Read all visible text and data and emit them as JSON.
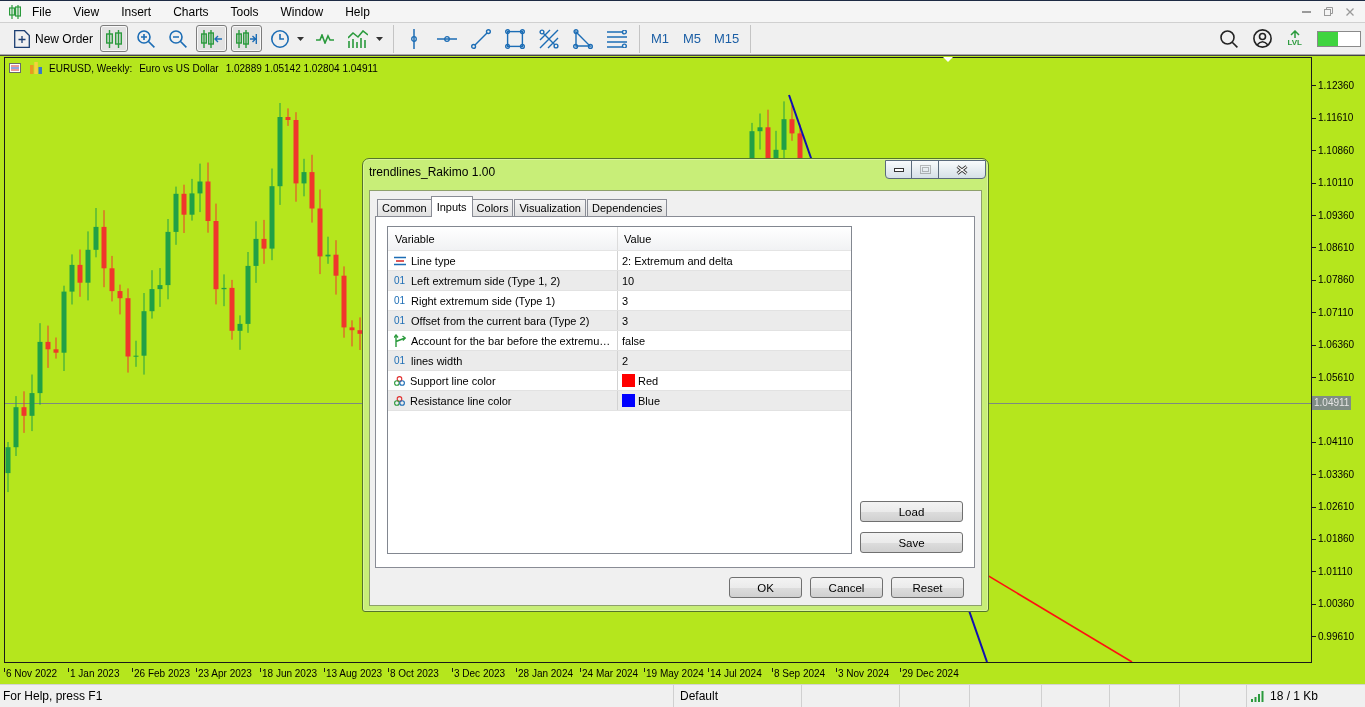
{
  "menu": {
    "items": [
      "File",
      "View",
      "Insert",
      "Charts",
      "Tools",
      "Window",
      "Help"
    ]
  },
  "toolbar": {
    "new_order": "New Order",
    "chart_tools": [
      {
        "kind": "candles",
        "pressed": true
      },
      {
        "kind": "zoom_in",
        "pressed": false
      },
      {
        "kind": "zoom_out",
        "pressed": false
      },
      {
        "kind": "chart_shift",
        "pressed": true
      },
      {
        "kind": "autoscroll",
        "pressed": true
      },
      {
        "kind": "clock",
        "pressed": false
      },
      {
        "kind": "dropdown",
        "pressed": false
      },
      {
        "kind": "indicator",
        "pressed": false
      },
      {
        "kind": "templates",
        "pressed": false
      },
      {
        "kind": "dropdown",
        "pressed": false
      }
    ],
    "drawing_tools": [
      {
        "kind": "vline",
        "pressed": false
      },
      {
        "kind": "hline",
        "pressed": false
      },
      {
        "kind": "trend",
        "pressed": false
      },
      {
        "kind": "rectangle",
        "pressed": false
      },
      {
        "kind": "crossed",
        "pressed": false
      },
      {
        "kind": "triangle",
        "pressed": false
      },
      {
        "kind": "channel",
        "pressed": false
      }
    ],
    "timeframes": [
      {
        "label": "M1",
        "selected": false
      },
      {
        "label": "M5",
        "selected": false
      },
      {
        "label": "M15",
        "selected": false
      }
    ],
    "level_badge": "LVL",
    "progress": {
      "level": 0.47
    }
  },
  "chart": {
    "symbol": "EURUSD, Weekly:",
    "description": "Euro vs US Dollar",
    "ohlc": "1.02889 1.05142 1.02804 1.04911",
    "price_axis": [
      {
        "kind": "tick",
        "text": "1.12360"
      },
      {
        "kind": "tick",
        "text": "1.11610"
      },
      {
        "kind": "tick",
        "text": "1.10860"
      },
      {
        "kind": "tick",
        "text": "1.10110"
      },
      {
        "kind": "tick",
        "text": "1.09360"
      },
      {
        "kind": "tick",
        "text": "1.08610"
      },
      {
        "kind": "tick",
        "text": "1.07860"
      },
      {
        "kind": "tick",
        "text": "1.07110"
      },
      {
        "kind": "tick",
        "text": "1.06360"
      },
      {
        "kind": "tick",
        "text": "1.05610"
      },
      {
        "kind": "current",
        "text": "1.04911"
      },
      {
        "kind": "tick",
        "text": "1.04110"
      },
      {
        "kind": "tick",
        "text": "1.03360"
      },
      {
        "kind": "tick",
        "text": "1.02610"
      },
      {
        "kind": "tick",
        "text": "1.01860"
      },
      {
        "kind": "tick",
        "text": "1.01110"
      },
      {
        "kind": "tick",
        "text": "1.00360"
      },
      {
        "kind": "tick",
        "text": "0.99610"
      }
    ],
    "time_axis": [
      "6 Nov 2022",
      "1 Jan 2023",
      "26 Feb 2023",
      "23 Apr 2023",
      "18 Jun 2023",
      "13 Aug 2023",
      "8 Oct 2023",
      "3 Dec 2023",
      "28 Jan 2024",
      "24 Mar 2024",
      "19 May 2024",
      "14 Jul 2024",
      "8 Sep 2024",
      "3 Nov 2024",
      "29 Dec 2024"
    ]
  },
  "dialog": {
    "title": "trendlines_Rakimo 1.00",
    "window_buttons": [
      {
        "kind": "minimize",
        "disabled": false
      },
      {
        "kind": "maximize",
        "disabled": true
      },
      {
        "kind": "close",
        "disabled": false
      }
    ],
    "tabs": [
      {
        "label": "Common",
        "selected": false
      },
      {
        "label": "Inputs",
        "selected": true
      },
      {
        "label": "Colors",
        "selected": false
      },
      {
        "label": "Visualization",
        "selected": false
      },
      {
        "label": "Dependencies",
        "selected": false
      }
    ],
    "columns": [
      "Variable",
      "Value"
    ],
    "rows": [
      {
        "kind": "enum",
        "variable": "Line type",
        "value": "2: Extremum and delta"
      },
      {
        "kind": "int",
        "type_label": "01",
        "variable": "Left extremum side (Type 1, 2)",
        "value": "10"
      },
      {
        "kind": "int",
        "type_label": "01",
        "variable": "Right extremum side (Type 1)",
        "value": "3"
      },
      {
        "kind": "int",
        "type_label": "01",
        "variable": "Offset from the current bara (Type 2)",
        "value": "3"
      },
      {
        "kind": "bool",
        "variable": "Account for the bar before the extremu…",
        "value": "false"
      },
      {
        "kind": "int",
        "type_label": "01",
        "variable": "lines width",
        "value": "2"
      },
      {
        "kind": "color",
        "variable": "Support line color",
        "value": "Red",
        "color": "#ff0000"
      },
      {
        "kind": "color",
        "variable": "Resistance line color",
        "value": "Blue",
        "color": "#0000ff"
      }
    ],
    "side_buttons": [
      "Load",
      "Save"
    ],
    "buttons": [
      "OK",
      "Cancel",
      "Reset"
    ]
  },
  "status_bar": {
    "help": "For Help, press F1",
    "profile": "Default",
    "traffic": "18 / 1 Kb"
  }
}
